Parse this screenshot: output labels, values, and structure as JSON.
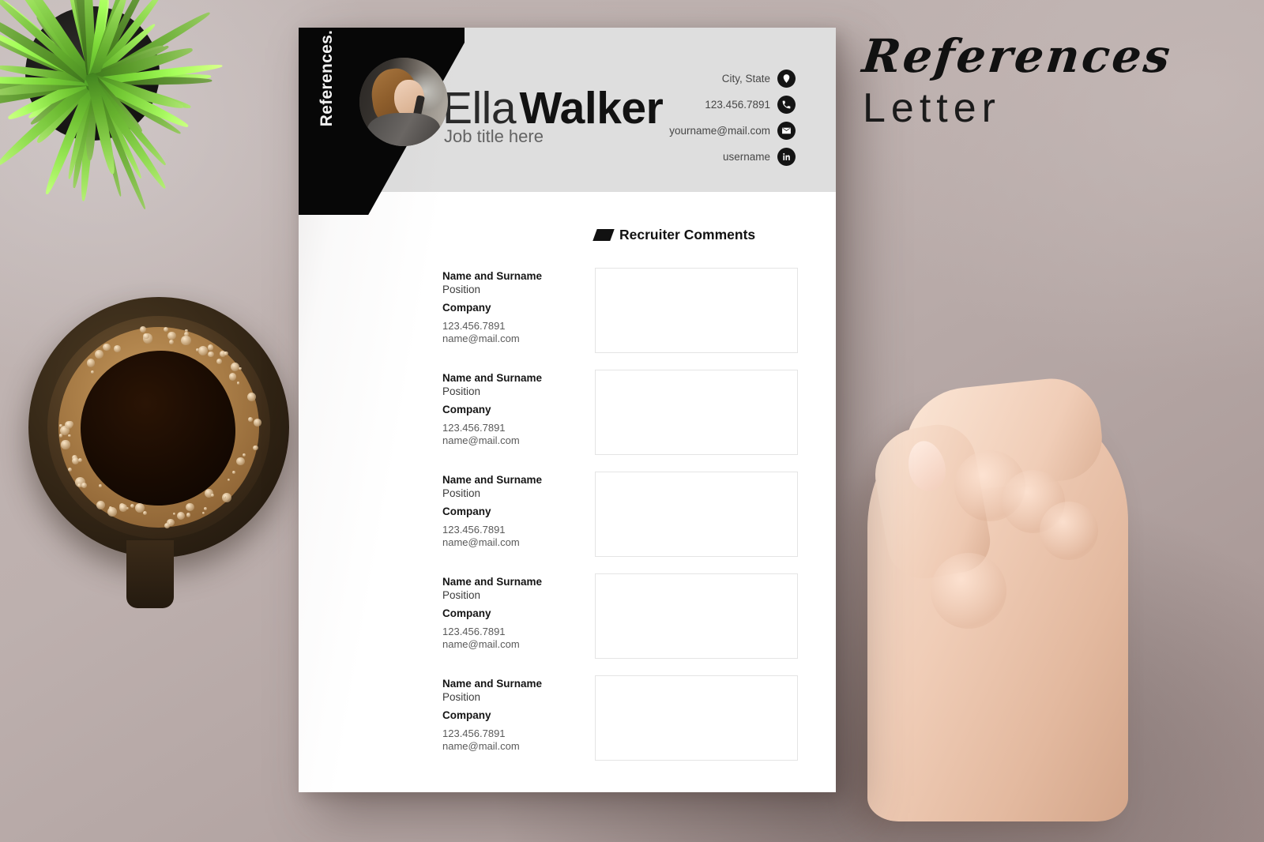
{
  "document": {
    "vertical_tab_label": "References.",
    "person": {
      "first_name": "Ella",
      "last_name": "Walker",
      "job_title": "Job title here"
    },
    "contact": [
      {
        "icon": "location-pin-icon",
        "value": "City, State"
      },
      {
        "icon": "phone-icon",
        "value": "123.456.7891"
      },
      {
        "icon": "envelope-icon",
        "value": "yourname@mail.com"
      },
      {
        "icon": "linkedin-icon",
        "value": "username"
      }
    ],
    "section": {
      "title": "Recruiter Comments",
      "marker_icon": "slanted-block-icon"
    },
    "references": [
      {
        "name": "Name and Surname",
        "position": "Position",
        "company": "Company",
        "phone": "123.456.7891",
        "email": "name@mail.com",
        "comment": ""
      },
      {
        "name": "Name and Surname",
        "position": "Position",
        "company": "Company",
        "phone": "123.456.7891",
        "email": "name@mail.com",
        "comment": ""
      },
      {
        "name": "Name and Surname",
        "position": "Position",
        "company": "Company",
        "phone": "123.456.7891",
        "email": "name@mail.com",
        "comment": ""
      },
      {
        "name": "Name and Surname",
        "position": "Position",
        "company": "Company",
        "phone": "123.456.7891",
        "email": "name@mail.com",
        "comment": ""
      },
      {
        "name": "Name and Surname",
        "position": "Position",
        "company": "Company",
        "phone": "123.456.7891",
        "email": "name@mail.com",
        "comment": ""
      }
    ]
  },
  "overlay_title": {
    "script_line": "References",
    "plain_line": "Letter"
  },
  "scene": {
    "plant_label": "potted-grass-plant",
    "cup_label": "cup-of-coffee",
    "hand_label": "hand-holding-pencil"
  },
  "colors": {
    "background": "#b4a7a5",
    "paper": "#ffffff",
    "header_band": "#dedede",
    "accent_black": "#070707",
    "box_border": "#e4e4e4",
    "muted_text": "#5a5a5a"
  }
}
